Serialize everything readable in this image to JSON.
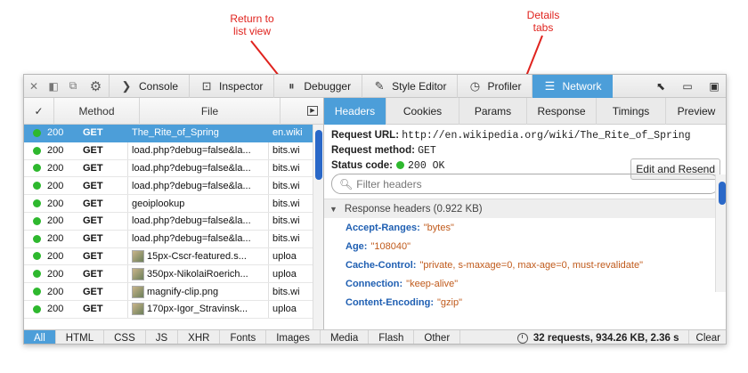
{
  "annotations": {
    "return_to_list": "Return to\nlist view",
    "details_tabs": "Details\ntabs",
    "color": "#e0231e"
  },
  "toolbar": {
    "close_icon": "close-icon",
    "tools": [
      {
        "label": "Console",
        "icon": "console-icon"
      },
      {
        "label": "Inspector",
        "icon": "inspector-icon"
      },
      {
        "label": "Debugger",
        "icon": "debugger-icon"
      },
      {
        "label": "Style Editor",
        "icon": "style-editor-icon"
      },
      {
        "label": "Profiler",
        "icon": "profiler-icon"
      },
      {
        "label": "Network",
        "icon": "network-icon",
        "active": true
      }
    ],
    "accent": "#4c9ed9"
  },
  "list": {
    "columns": [
      "✓",
      "Method",
      "File"
    ],
    "rows": [
      {
        "status": "200",
        "method": "GET",
        "file": "The_Rite_of_Spring",
        "domain": "en.wiki",
        "selected": true,
        "thumb": false
      },
      {
        "status": "200",
        "method": "GET",
        "file": "load.php?debug=false&la...",
        "domain": "bits.wi",
        "thumb": false
      },
      {
        "status": "200",
        "method": "GET",
        "file": "load.php?debug=false&la...",
        "domain": "bits.wi",
        "thumb": false
      },
      {
        "status": "200",
        "method": "GET",
        "file": "load.php?debug=false&la...",
        "domain": "bits.wi",
        "thumb": false
      },
      {
        "status": "200",
        "method": "GET",
        "file": "geoiplookup",
        "domain": "bits.wi",
        "thumb": false
      },
      {
        "status": "200",
        "method": "GET",
        "file": "load.php?debug=false&la...",
        "domain": "bits.wi",
        "thumb": false
      },
      {
        "status": "200",
        "method": "GET",
        "file": "load.php?debug=false&la...",
        "domain": "bits.wi",
        "thumb": false
      },
      {
        "status": "200",
        "method": "GET",
        "file": "15px-Cscr-featured.s...",
        "domain": "uploa",
        "thumb": true
      },
      {
        "status": "200",
        "method": "GET",
        "file": "350px-NikolaiRoerich...",
        "domain": "uploa",
        "thumb": true
      },
      {
        "status": "200",
        "method": "GET",
        "file": "magnify-clip.png",
        "domain": "bits.wi",
        "thumb": true
      },
      {
        "status": "200",
        "method": "GET",
        "file": "170px-Igor_Stravinsk...",
        "domain": "uploa",
        "thumb": true
      }
    ]
  },
  "details": {
    "tabs": [
      "Headers",
      "Cookies",
      "Params",
      "Response",
      "Timings",
      "Preview"
    ],
    "active_tab": "Headers",
    "request_url_label": "Request URL:",
    "request_url": "http://en.wikipedia.org/wiki/The_Rite_of_Spring",
    "request_method_label": "Request method:",
    "request_method": "GET",
    "status_code_label": "Status code:",
    "status_code": "200 OK",
    "resend_label": "Edit and Resend",
    "filter_placeholder": "Filter headers",
    "response_headers_title": "Response headers (0.922 KB)",
    "headers": [
      {
        "name": "Accept-Ranges:",
        "value": "\"bytes\""
      },
      {
        "name": "Age:",
        "value": "\"108040\""
      },
      {
        "name": "Cache-Control:",
        "value": "\"private, s-maxage=0, max-age=0, must-revalidate\""
      },
      {
        "name": "Connection:",
        "value": "\"keep-alive\""
      },
      {
        "name": "Content-Encoding:",
        "value": "\"gzip\""
      }
    ]
  },
  "footer": {
    "filters": [
      "All",
      "HTML",
      "CSS",
      "JS",
      "XHR",
      "Fonts",
      "Images",
      "Media",
      "Flash",
      "Other"
    ],
    "active_filter": "All",
    "summary": "32 requests, 934.26 KB, 2.36 s",
    "clear_label": "Clear"
  }
}
